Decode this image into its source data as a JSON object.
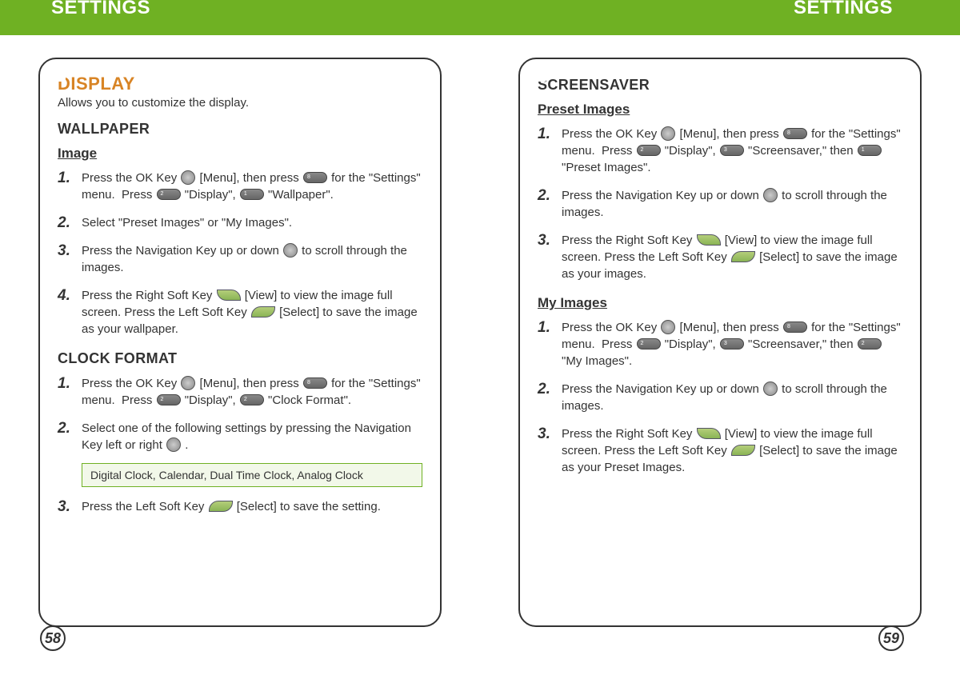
{
  "header": {
    "left": "SETTINGS",
    "right": "SETTINGS"
  },
  "left": {
    "pagenum": "58",
    "title": "DISPLAY",
    "subtitle": "Allows you to customize the display.",
    "wallpaper_h2": "WALLPAPER",
    "image_h3": "Image",
    "image_steps": [
      "Press the OK Key ⬤ [Menu], then press ▭ for the \"Settings\" menu.  Press ▭ \"Display\", ▭ \"Wallpaper\".",
      "Select \"Preset Images\" or \"My Images\".",
      "Press the Navigation Key up or down ⬤ to scroll through the images.",
      "Press the Right Soft Key ▭ [View] to view the image full screen. Press the Left Soft Key ▭ [Select] to save the image as your wallpaper."
    ],
    "clock_h2": "CLOCK FORMAT",
    "clock_steps_pre": [
      "Press the OK Key ⬤ [Menu], then press ▭ for the \"Settings\" menu.  Press ▭ \"Display\", ▭ \"Clock Format\".",
      "Select one of the following settings by pressing the Navigation Key left or right ⬤ ."
    ],
    "clock_options": "Digital Clock, Calendar, Dual Time Clock, Analog Clock",
    "clock_steps_post": [
      "Press the Left Soft Key ▭ [Select] to save the setting."
    ]
  },
  "right": {
    "pagenum": "59",
    "screensaver_h2": "SCREENSAVER",
    "preset_h3": "Preset Images",
    "preset_steps": [
      "Press the OK Key ⬤ [Menu], then press ▭ for the \"Settings\" menu.  Press ▭ \"Display\", ▭ \"Screensaver,\" then ▭ \"Preset Images\".",
      "Press the Navigation Key up or down ⬤ to scroll through the images.",
      "Press the Right Soft Key ▭ [View] to view the image full screen. Press the Left Soft Key ▭ [Select] to save the image as your images."
    ],
    "myimages_h3": "My Images",
    "myimages_steps": [
      "Press the OK Key ⬤ [Menu], then press ▭ for the \"Settings\" menu.  Press ▭ \"Display\", ▭ \"Screensaver,\" then ▭ \"My Images\".",
      "Press the Navigation Key up or down ⬤ to scroll through the images.",
      "Press the Right Soft Key ▭ [View] to view the image full screen. Press the Left Soft Key ▭ [Select] to save the image as your Preset Images."
    ]
  }
}
